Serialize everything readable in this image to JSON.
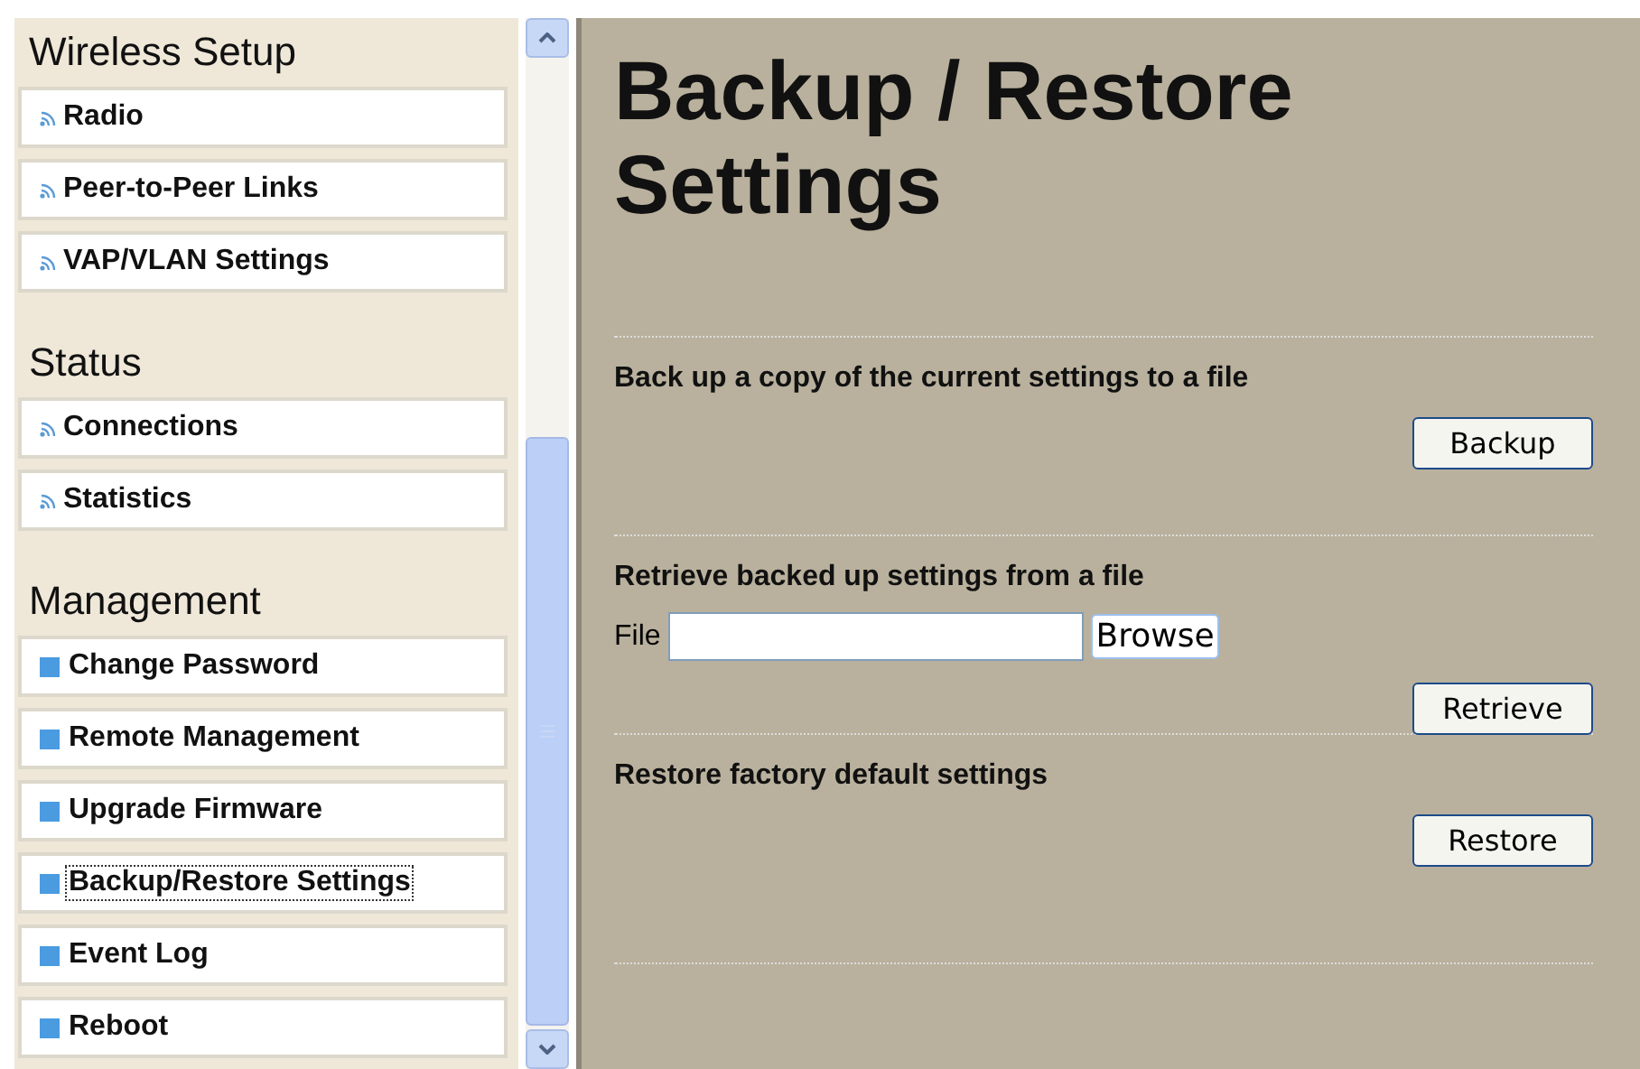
{
  "sidebar": {
    "groups": [
      {
        "title": "Wireless Setup",
        "kind": "wireless",
        "items": [
          {
            "label": "Radio",
            "selected": false
          },
          {
            "label": "Peer-to-Peer Links",
            "selected": false
          },
          {
            "label": "VAP/VLAN Settings",
            "selected": false
          }
        ]
      },
      {
        "title": "Status",
        "kind": "wireless",
        "items": [
          {
            "label": "Connections",
            "selected": false
          },
          {
            "label": "Statistics",
            "selected": false
          }
        ]
      },
      {
        "title": "Management",
        "kind": "square",
        "items": [
          {
            "label": "Change Password",
            "selected": false
          },
          {
            "label": "Remote Management",
            "selected": false
          },
          {
            "label": "Upgrade Firmware",
            "selected": false
          },
          {
            "label": "Backup/Restore Settings",
            "selected": true
          },
          {
            "label": "Event Log",
            "selected": false
          },
          {
            "label": "Reboot",
            "selected": false
          }
        ]
      }
    ]
  },
  "main": {
    "title": "Backup / Restore Settings",
    "sections": [
      {
        "heading": "Back up a copy of the current settings to a file",
        "button": "Backup"
      },
      {
        "heading": "Retrieve backed up settings from a file",
        "file_label": "File",
        "browse": "Browse",
        "button": "Retrieve"
      },
      {
        "heading": "Restore factory default settings",
        "button": "Restore"
      }
    ]
  }
}
